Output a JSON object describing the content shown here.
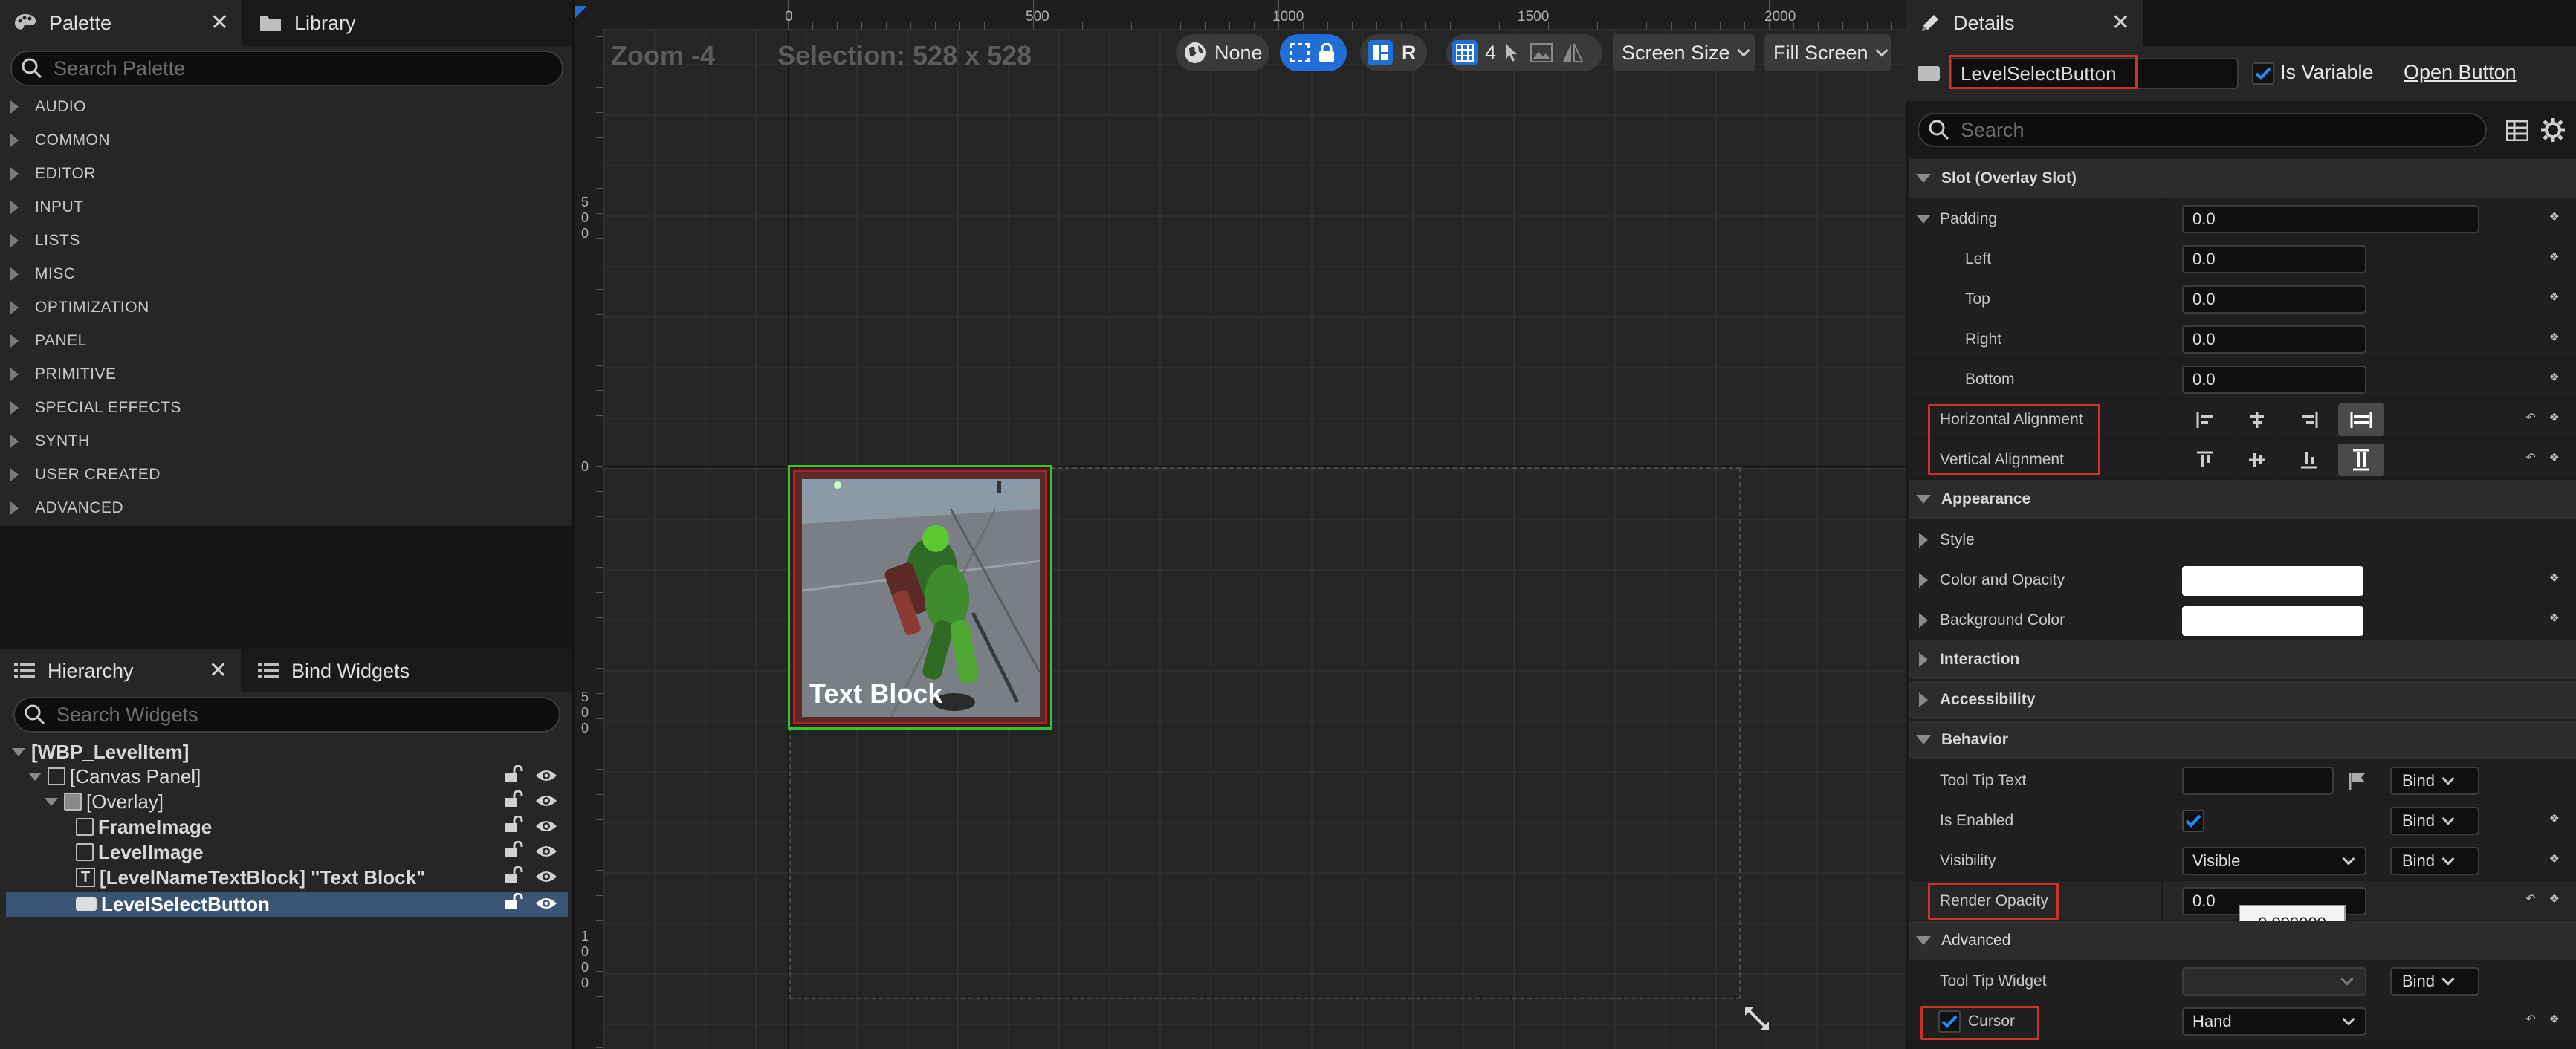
{
  "palette": {
    "tab_label": "Palette",
    "library_tab_label": "Library",
    "search_placeholder": "Search Palette",
    "categories": [
      "AUDIO",
      "COMMON",
      "EDITOR",
      "INPUT",
      "LISTS",
      "MISC",
      "OPTIMIZATION",
      "PANEL",
      "PRIMITIVE",
      "SPECIAL EFFECTS",
      "SYNTH",
      "USER CREATED",
      "ADVANCED"
    ]
  },
  "hierarchy": {
    "tab_label": "Hierarchy",
    "bind_tab_label": "Bind Widgets",
    "search_placeholder": "Search Widgets",
    "items": [
      {
        "label": "[WBP_LevelItem]"
      },
      {
        "label": "[Canvas Panel]"
      },
      {
        "label": "[Overlay]"
      },
      {
        "label": "FrameImage"
      },
      {
        "label": "LevelImage"
      },
      {
        "label": "[LevelNameTextBlock] \"Text Block\""
      },
      {
        "label": "LevelSelectButton"
      }
    ]
  },
  "viewport": {
    "zoom": "Zoom -4",
    "selection": "Selection: 528 x 528",
    "ruler_top": [
      "0",
      "500",
      "1000",
      "1500",
      "2000"
    ],
    "ruler_left": [
      "5\n0\n0",
      "0",
      "5\n0\n0",
      "1\n0\n0\n0"
    ],
    "locale_label": "None",
    "grid_value": "4",
    "r_label": "R",
    "screen_size_label": "Screen Size",
    "fill_screen_label": "Fill Screen",
    "widget_text": "Text Block"
  },
  "details": {
    "tab_label": "Details",
    "widget_name": "LevelSelectButton",
    "is_variable_label": "Is Variable",
    "open_button_label": "Open Button",
    "search_placeholder": "Search",
    "slot_section": "Slot (Overlay Slot)",
    "padding_label": "Padding",
    "padding_value": "0.0",
    "left_label": "Left",
    "left_value": "0.0",
    "top_label": "Top",
    "top_value": "0.0",
    "right_label": "Right",
    "right_value": "0.0",
    "bottom_label": "Bottom",
    "bottom_value": "0.0",
    "h_align_label": "Horizontal Alignment",
    "v_align_label": "Vertical Alignment",
    "appearance_section": "Appearance",
    "style_label": "Style",
    "color_opacity_label": "Color and Opacity",
    "background_color_label": "Background Color",
    "interaction_section": "Interaction",
    "accessibility_section": "Accessibility",
    "behavior_section": "Behavior",
    "tooltip_text_label": "Tool Tip Text",
    "is_enabled_label": "Is Enabled",
    "visibility_label": "Visibility",
    "visibility_value": "Visible",
    "render_opacity_label": "Render Opacity",
    "render_opacity_value": "0.0",
    "render_opacity_tooltip": "0.000000",
    "advanced_section": "Advanced",
    "tooltip_widget_label": "Tool Tip Widget",
    "cursor_label": "Cursor",
    "cursor_value": "Hand",
    "bind_label": "Bind"
  },
  "colors": {
    "highlight_red": "#c8342a",
    "accent_blue": "#1f6fd6",
    "selected_row": "#3a5473"
  }
}
